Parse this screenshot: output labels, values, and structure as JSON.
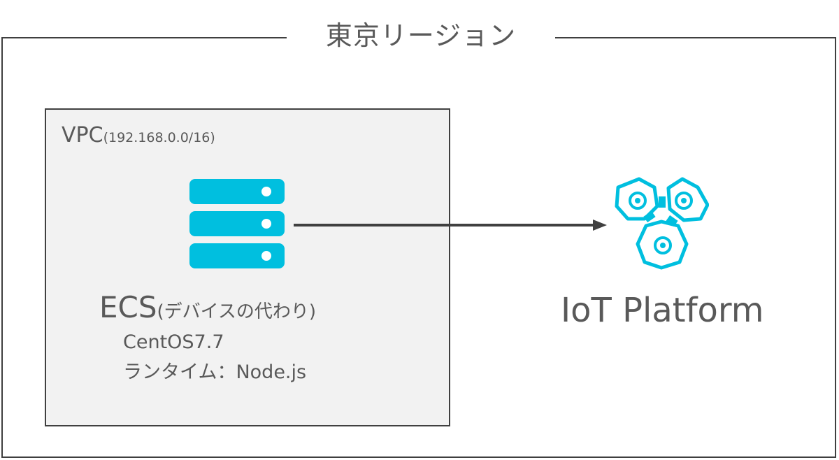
{
  "region": {
    "title": "東京リージョン"
  },
  "vpc": {
    "name": "VPC",
    "cidr": "(192.168.0.0/16)"
  },
  "ecs": {
    "name": "ECS",
    "note": "(デバイスの代わり)",
    "os": "CentOS7.7",
    "runtime": "ランタイム：Node.js",
    "icon": "server-icon"
  },
  "iot": {
    "label": "IoT Platform",
    "icon": "iot-platform-icon"
  },
  "colors": {
    "accent": "#00bfdf",
    "text": "#595959",
    "border": "#3f3f3f",
    "vpc_fill": "#f2f2f2",
    "arrow": "#404040"
  }
}
